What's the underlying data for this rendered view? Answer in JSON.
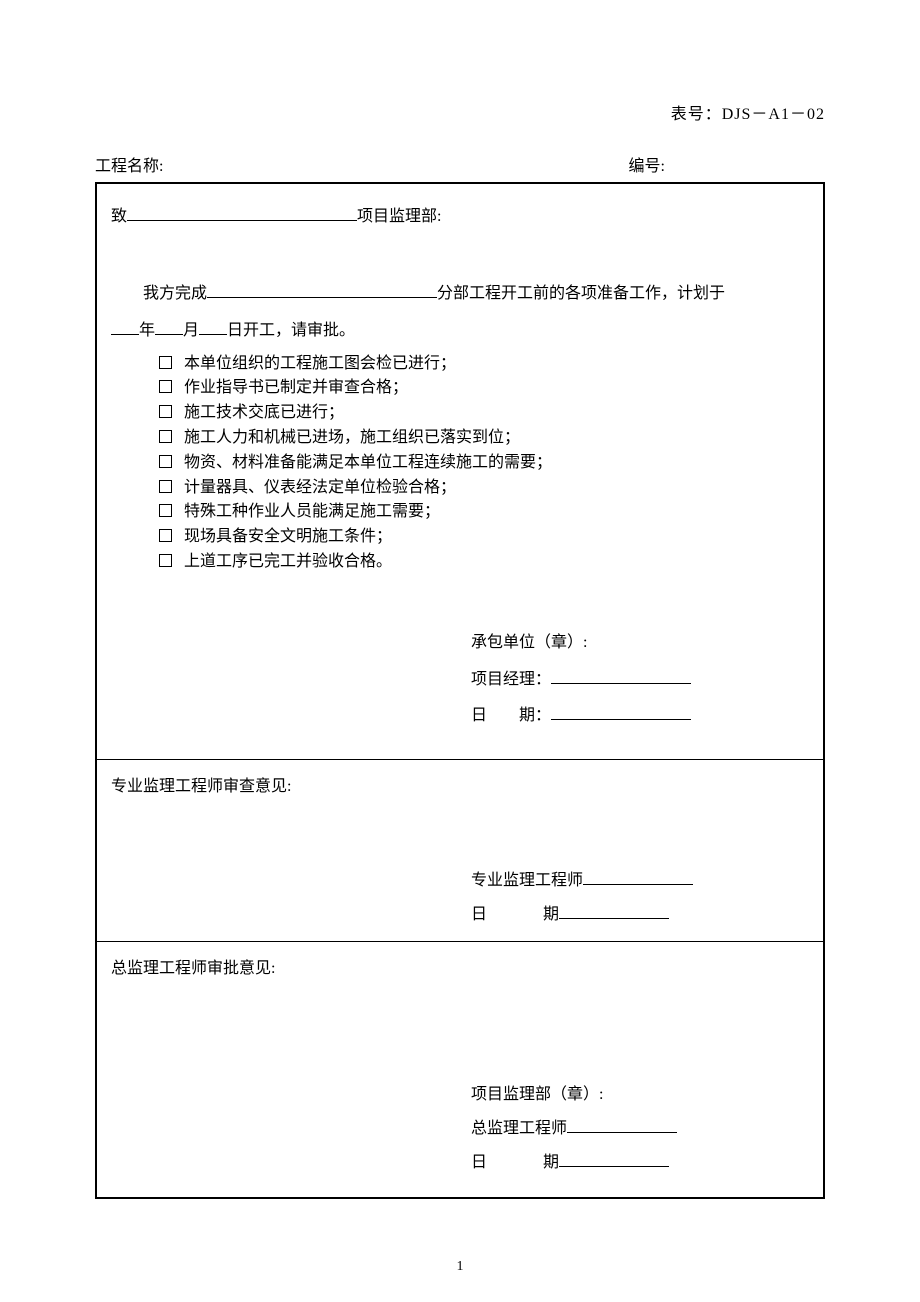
{
  "header": {
    "form_number_label": "表号：DJS－A1－02",
    "project_name_label": "工程名称:",
    "serial_label": "编号:"
  },
  "section1": {
    "to_prefix": "致",
    "to_suffix": "项目监理部:",
    "body_prefix": "我方完成",
    "body_suffix": "分部工程开工前的各项准备工作，计划于",
    "date_line": "年___月___日开工，请审批。",
    "year": "年",
    "month": "月",
    "day": "日开工，请审批。",
    "checklist": [
      "本单位组织的工程施工图会检已进行；",
      "作业指导书已制定并审查合格；",
      "施工技术交底已进行；",
      "施工人力和机械已进场，施工组织已落实到位；",
      "物资、材料准备能满足本单位工程连续施工的需要；",
      "计量器具、仪表经法定单位检验合格；",
      "特殊工种作业人员能满足施工需要；",
      "现场具备安全文明施工条件；",
      "上道工序已完工并验收合格。"
    ],
    "contractor_label": "承包单位（章）:",
    "pm_label": "项目经理：",
    "date_label": "日　　期："
  },
  "section2": {
    "title": "专业监理工程师审查意见:",
    "engineer_label": "专业监理工程师",
    "date_label": "日",
    "date_label2": "期"
  },
  "section3": {
    "title": "总监理工程师审批意见:",
    "dept_label": "项目监理部（章）:",
    "chief_label": "总监理工程师",
    "date_label": "日",
    "date_label2": "期"
  },
  "page_number": "1"
}
